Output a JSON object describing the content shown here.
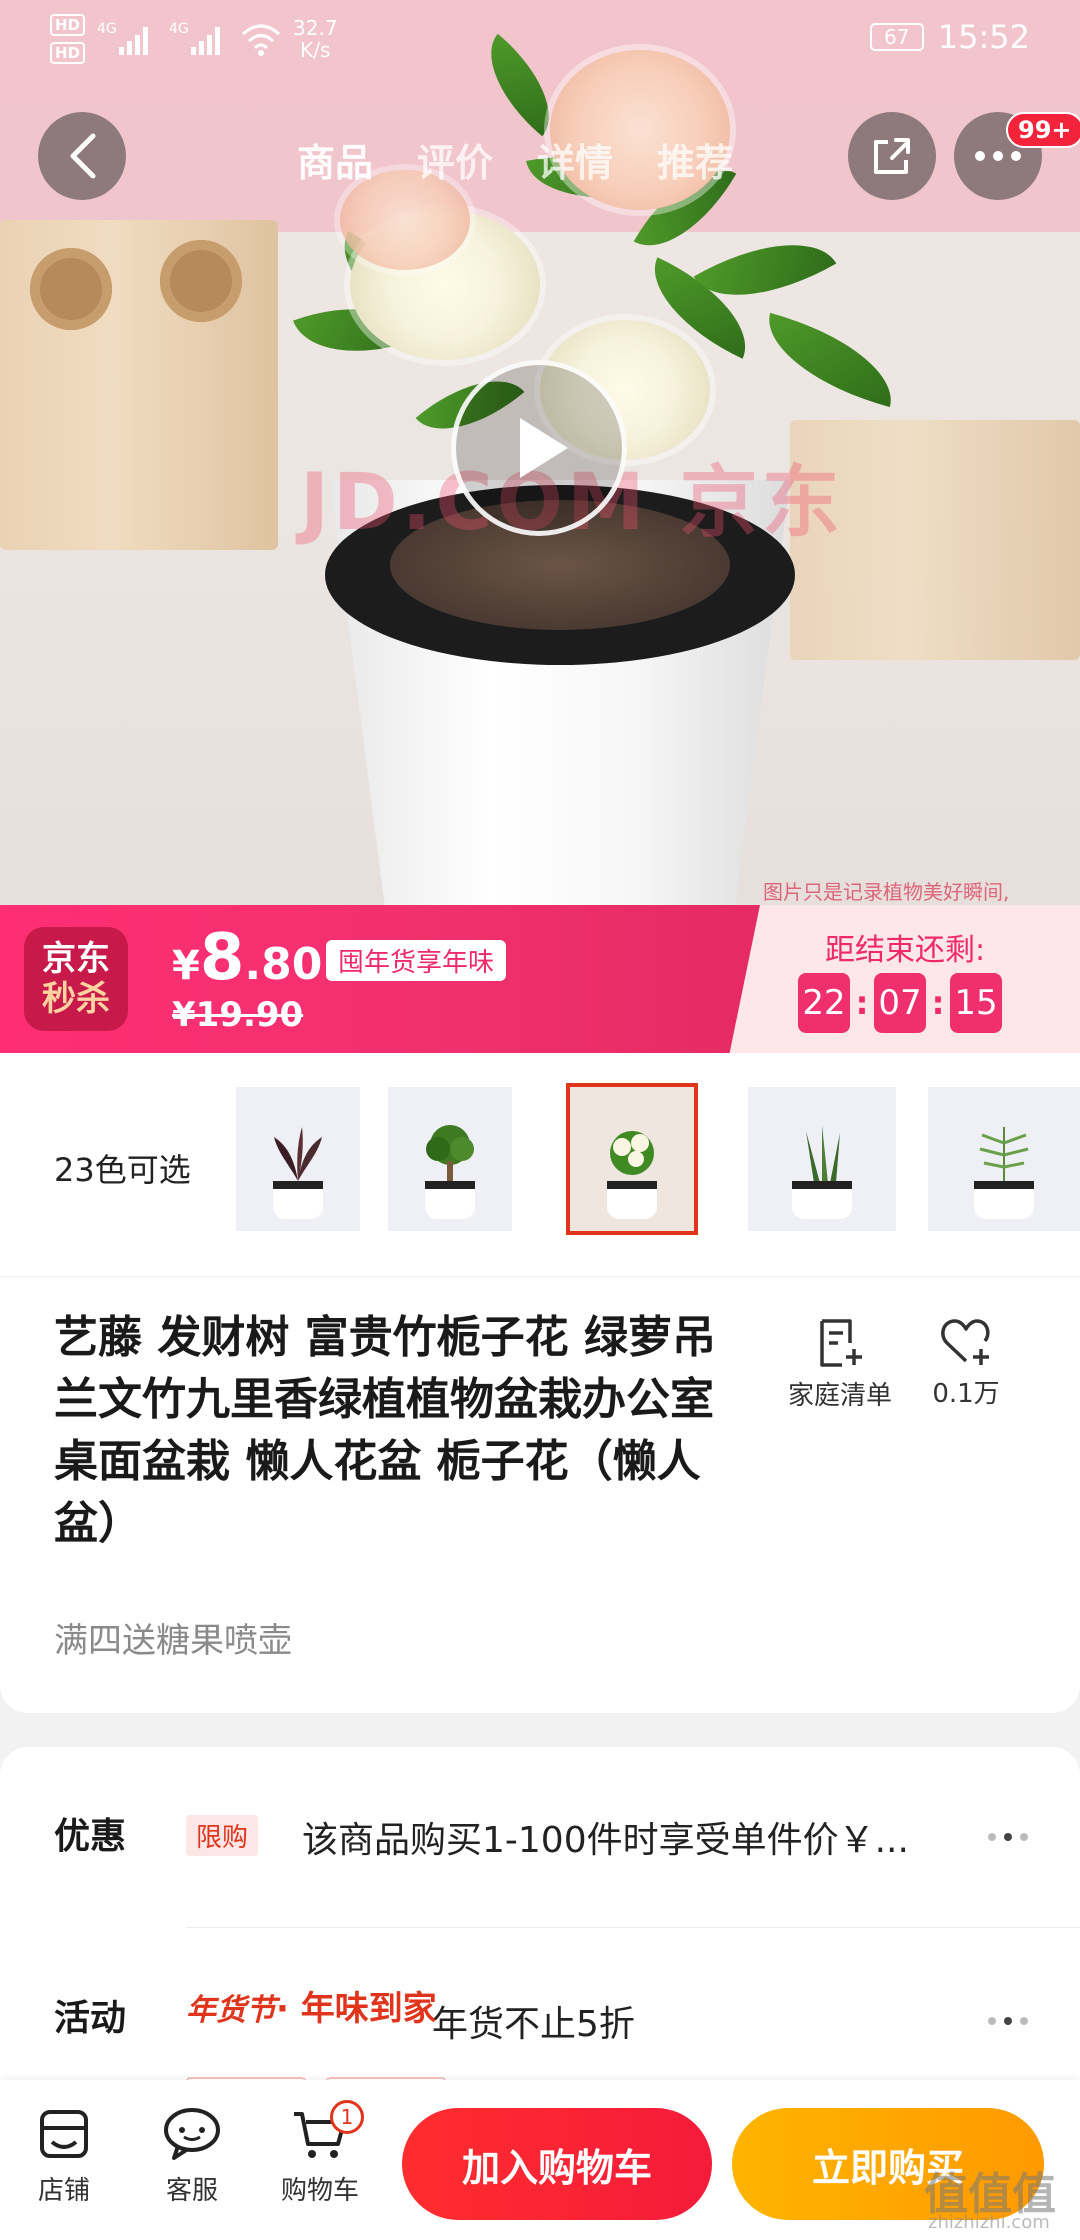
{
  "status_bar": {
    "hd1": "HD",
    "hd2": "HD",
    "net_speed": "32.7",
    "net_unit": "K/s",
    "battery": "67",
    "time": "15:52"
  },
  "nav": {
    "tabs": [
      "商品",
      "评价",
      "详情",
      "推荐"
    ],
    "more_badge": "99+"
  },
  "hero": {
    "watermark": "JD.COM 京东",
    "photo_note": "图片只是记录植物美好瞬间,"
  },
  "flash_sale": {
    "logo_line1": "京东",
    "logo_line2": "秒杀",
    "currency": "¥",
    "price_int": "8",
    "price_dec": ".80",
    "old_price": "¥19.90",
    "promo_tag": "囤年货享年味",
    "countdown_label": "距结束还剩:",
    "countdown": [
      "22",
      "07",
      "15"
    ]
  },
  "variants": {
    "count_label": "23色可选",
    "selected_index": 2
  },
  "product": {
    "title": "艺藤  发财树 富贵竹栀子花 绿萝吊兰文竹九里香绿植植物盆栽办公室桌面盆栽   懒人花盆 栀子花（懒人盆）",
    "subtitle": "满四送糖果喷壶",
    "actions": {
      "list_label": "家庭清单",
      "fav_count": "0.1万"
    }
  },
  "promo": {
    "discount_label": "优惠",
    "limit_tag": "限购",
    "discount_text": "该商品购买1-100件时享受单件价￥...",
    "activity_label": "活动",
    "activity_tag_script": "年货节",
    "activity_tag_text": "· 年味到家",
    "activity_text": "年货不止5折"
  },
  "bottom_bar": {
    "store_label": "店铺",
    "service_label": "客服",
    "cart_label": "购物车",
    "cart_count": "1",
    "add_to_cart": "加入购物车",
    "buy_now": "立即购买"
  },
  "site_watermark": {
    "logo": "值值值",
    "url": "zhizhizhi.com"
  },
  "colors": {
    "flash_pink": "#f0306e",
    "jd_red": "#e0341c",
    "buy_orange": "#ffa800"
  }
}
